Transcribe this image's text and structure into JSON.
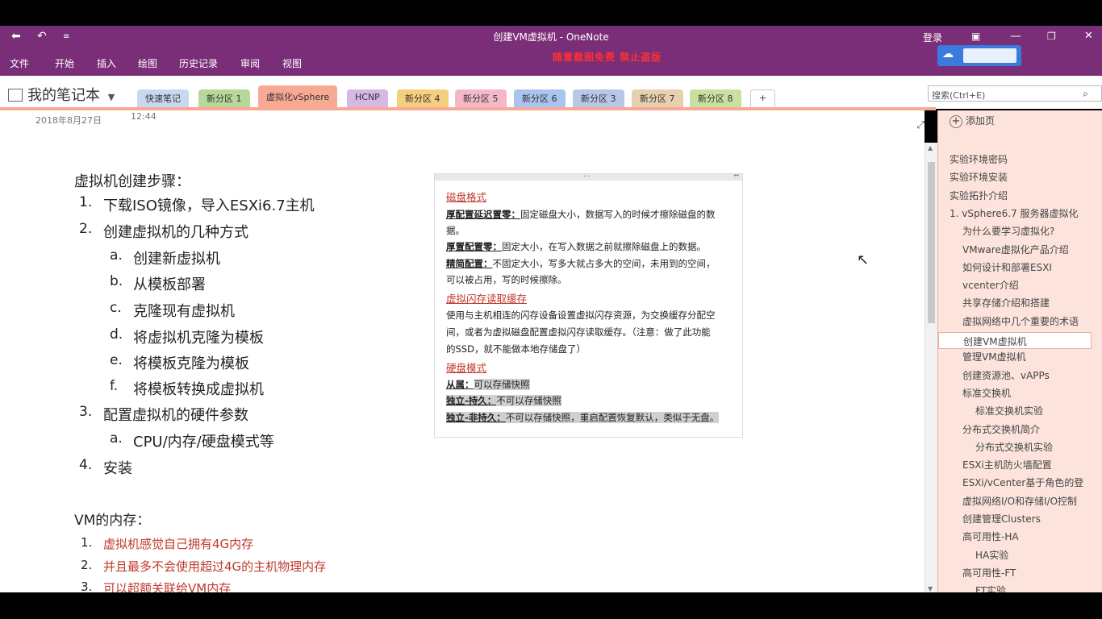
{
  "window": {
    "title": "创建VM虚拟机 - OneNote",
    "login": "登录",
    "promo": "随意截图免费 禁止盗版"
  },
  "ribbon": [
    "文件",
    "开始",
    "插入",
    "绘图",
    "历史记录",
    "审阅",
    "视图"
  ],
  "notebook": {
    "name": "我的笔记本"
  },
  "tabs": [
    {
      "label": "快速笔记",
      "color": "#c8d8f0"
    },
    {
      "label": "新分区 1",
      "color": "#b6d89a"
    },
    {
      "label": "虚拟化vSphere",
      "color": "#f7a994",
      "active": true
    },
    {
      "label": "HCNP",
      "color": "#d6b8e6"
    },
    {
      "label": "新分区 4",
      "color": "#f5cf7e"
    },
    {
      "label": "新分区 5",
      "color": "#f5b8c8"
    },
    {
      "label": "新分区 6",
      "color": "#a9c4ee"
    },
    {
      "label": "新分区 3",
      "color": "#b8c6e8"
    },
    {
      "label": "新分区 7",
      "color": "#e6d0b0"
    },
    {
      "label": "新分区 8",
      "color": "#c8e0a0"
    },
    {
      "label": "+",
      "color": "#ffffff"
    }
  ],
  "search": {
    "placeholder": "搜索(Ctrl+E)"
  },
  "page": {
    "date": "2018年8月27日",
    "time": "12:44",
    "heading": "虚拟机创建步骤：",
    "steps": [
      {
        "num": "1.",
        "text": "下载ISO镜像，导入ESXi6.7主机"
      },
      {
        "num": "2.",
        "text": "创建虚拟机的几种方式"
      },
      {
        "num": "a.",
        "text": "创建新虚拟机"
      },
      {
        "num": "b.",
        "text": "从模板部署"
      },
      {
        "num": "c.",
        "text": "克隆现有虚拟机"
      },
      {
        "num": "d.",
        "text": "将虚拟机克隆为模板"
      },
      {
        "num": "e.",
        "text": "将模板克隆为模板"
      },
      {
        "num": "f.",
        "text": "将模板转换成虚拟机"
      },
      {
        "num": "3.",
        "text": "配置虚拟机的硬件参数"
      },
      {
        "num": "a.",
        "text": "CPU/内存/硬盘模式等"
      },
      {
        "num": "4.",
        "text": "安装"
      }
    ],
    "mem_heading": "VM的内存：",
    "mem_items": [
      {
        "num": "1.",
        "text": "虚拟机感觉自己拥有4G内存"
      },
      {
        "num": "2.",
        "text": "并且最多不会使用超过4G的主机物理内存"
      },
      {
        "num": "3.",
        "text": "可以超额关联给VM内存"
      }
    ],
    "box": {
      "h1": "磁盘格式",
      "l1a": "厚配置延迟置零：",
      "l1b": "固定磁盘大小，数据写入的时候才擦除磁盘的数",
      "l1c": "据。",
      "l2a": "厚置配置零：",
      "l2b": "固定大小，在写入数据之前就擦除磁盘上的数据。",
      "l3a": "精简配置：",
      "l3b": "不固定大小，写多大就占多大的空间，未用到的空间，",
      "l3c": "可以被占用，写的时候擦除。",
      "h2": "虚拟闪存读取缓存",
      "p1": "使用与主机相连的闪存设备设置虚拟闪存资源，为交换缓存分配空",
      "p2": "间，或者为虚拟磁盘配置虚拟闪存读取缓存。（注意：做了此功能",
      "p3": "的SSD，就不能做本地存储盘了）",
      "h3": "硬盘模式",
      "m1a": "从属：",
      "m1b": "可以存储快照",
      "m2a": "独立-持久：",
      "m2b": "不可以存储快照",
      "m3a": "独立-非持久：",
      "m3b": "不可以存储快照，重启配置恢复默认，类似于无盘。"
    }
  },
  "pages_pane": {
    "add_page": "添加页",
    "pages": [
      {
        "label": "实验环境密码",
        "indent": 0
      },
      {
        "label": "实验环境安装",
        "indent": 0
      },
      {
        "label": "实验拓扑介绍",
        "indent": 0
      },
      {
        "label": "1. vSphere6.7 服务器虚拟化",
        "indent": 0
      },
      {
        "label": "为什么要学习虚拟化?",
        "indent": 1
      },
      {
        "label": "VMware虚拟化产品介绍",
        "indent": 1
      },
      {
        "label": "如何设计和部署ESXI",
        "indent": 1
      },
      {
        "label": "vcenter介绍",
        "indent": 1
      },
      {
        "label": "共享存储介绍和搭建",
        "indent": 1
      },
      {
        "label": "虚拟网络中几个重要的术语",
        "indent": 1
      },
      {
        "label": "创建VM虚拟机",
        "indent": 1,
        "selected": true
      },
      {
        "label": "管理VM虚拟机",
        "indent": 1
      },
      {
        "label": "创建资源池、vAPPs",
        "indent": 1
      },
      {
        "label": "标准交换机",
        "indent": 1
      },
      {
        "label": "标准交换机实验",
        "indent": 2
      },
      {
        "label": "分布式交换机简介",
        "indent": 1
      },
      {
        "label": "分布式交换机实验",
        "indent": 2
      },
      {
        "label": "ESXi主机防火墙配置",
        "indent": 1
      },
      {
        "label": "ESXi/vCenter基于角色的登",
        "indent": 1
      },
      {
        "label": "虚拟网络I/O和存储I/O控制",
        "indent": 1
      },
      {
        "label": "创建管理Clusters",
        "indent": 1
      },
      {
        "label": "高可用性-HA",
        "indent": 1
      },
      {
        "label": "HA实验",
        "indent": 2
      },
      {
        "label": "高可用性-FT",
        "indent": 1
      },
      {
        "label": "FT实验",
        "indent": 2
      }
    ]
  },
  "colors": {
    "titlebar": "#7b2e78",
    "accent": "#f7a994",
    "pane": "#fce4dc"
  }
}
